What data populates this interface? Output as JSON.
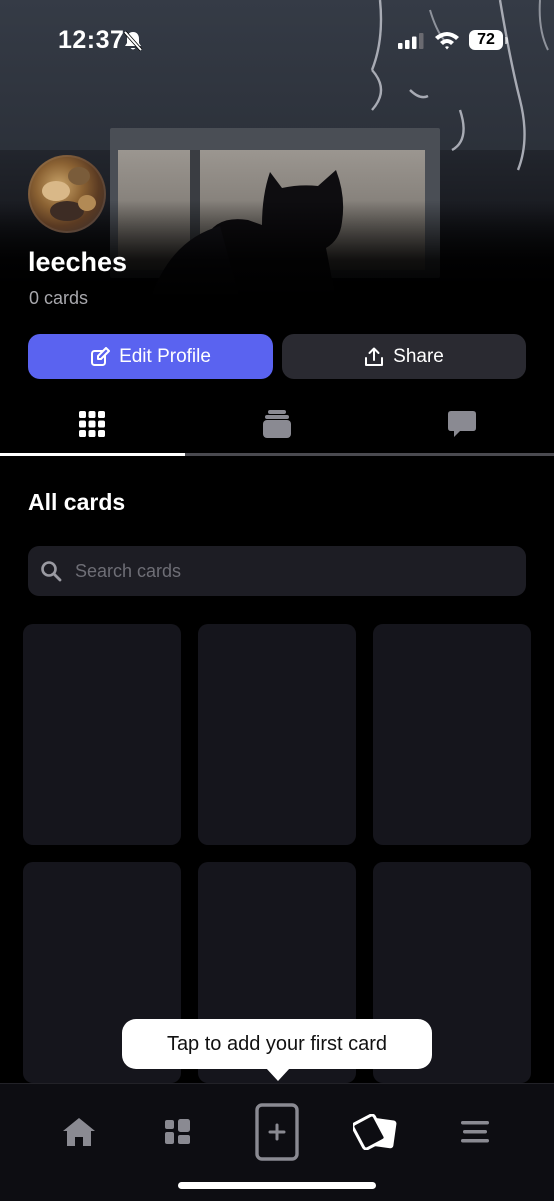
{
  "status_bar": {
    "time": "12:37",
    "battery": "72"
  },
  "profile": {
    "username": "leeches",
    "card_count": "0 cards",
    "edit_button": "Edit Profile",
    "share_button": "Share"
  },
  "tabs": [
    {
      "name": "grid",
      "icon": "grid-icon",
      "active": true
    },
    {
      "name": "stack",
      "icon": "card-stack-icon",
      "active": false
    },
    {
      "name": "comments",
      "icon": "chat-icon",
      "active": false
    }
  ],
  "content": {
    "section_title": "All cards",
    "search_placeholder": "Search cards",
    "placeholder_cards": 6
  },
  "tooltip": {
    "text": "Tap to add your first card"
  },
  "nav": [
    {
      "name": "home",
      "icon": "home-icon"
    },
    {
      "name": "dashboard",
      "icon": "dashboard-icon"
    },
    {
      "name": "add-card",
      "icon": "add-card-icon"
    },
    {
      "name": "cards",
      "icon": "cards-icon"
    },
    {
      "name": "menu",
      "icon": "menu-icon"
    }
  ],
  "colors": {
    "accent": "#5a63f0",
    "background": "#000000",
    "surface": "#15151c",
    "button_secondary": "#2a2a31"
  }
}
